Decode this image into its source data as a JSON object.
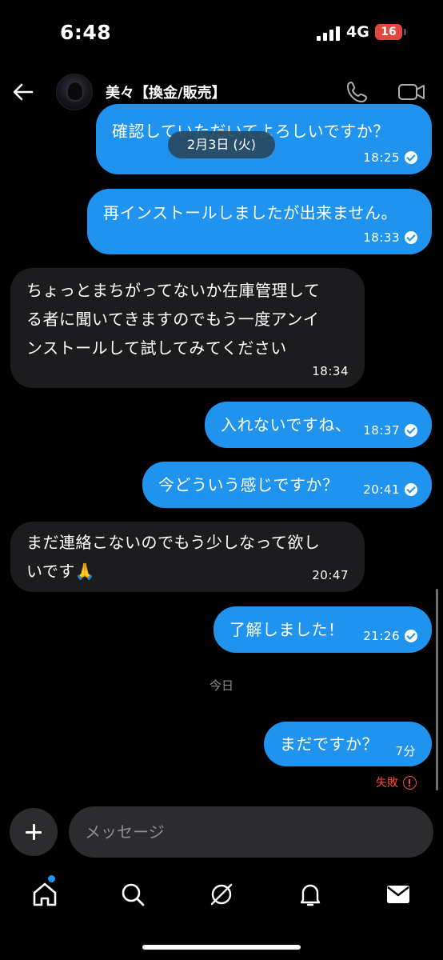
{
  "status_bar": {
    "time": "6:48",
    "network": "4G",
    "battery": "16"
  },
  "header": {
    "contact_name": "美々【換金/販売】"
  },
  "date_chip": "2月3日 (火)",
  "messages": [
    {
      "dir": "out",
      "text": "確認していただいてよろしいですか？",
      "time": "18:25",
      "read": true
    },
    {
      "dir": "out",
      "text": "再インストールしましたが出来ません。",
      "time": "18:33",
      "read": true
    },
    {
      "dir": "in",
      "lines": [
        "ちょっとまちがってないか在庫管理して",
        "る者に聞いてきますのでもう一度アンイ",
        "ンストールして試してみてください"
      ],
      "time": "18:34"
    },
    {
      "dir": "out",
      "text": "入れないですね、",
      "time": "18:37",
      "read": true
    },
    {
      "dir": "out",
      "text": "今どういう感じですか？",
      "time": "20:41",
      "read": true
    },
    {
      "dir": "in",
      "lines": [
        "まだ連絡こないのでもう少しなって欲し",
        "いです🙏"
      ],
      "time": "20:47"
    },
    {
      "dir": "out",
      "text": "了解しました！",
      "time": "21:26",
      "read": true
    },
    {
      "dir": "out",
      "text": "まだですか？",
      "time": "7分",
      "read": false
    }
  ],
  "day_separator": "今日",
  "failed_status": "失敗",
  "composer": {
    "placeholder": "メッセージ"
  },
  "colors": {
    "outgoing_bubble": "#1f93ee",
    "incoming_bubble": "#1c1c1e",
    "error": "#ff453a",
    "background": "#000000"
  },
  "nav": {
    "items": [
      "home-icon",
      "search-icon",
      "explore-icon",
      "notifications-icon",
      "messages-icon"
    ],
    "active": "home-icon"
  }
}
